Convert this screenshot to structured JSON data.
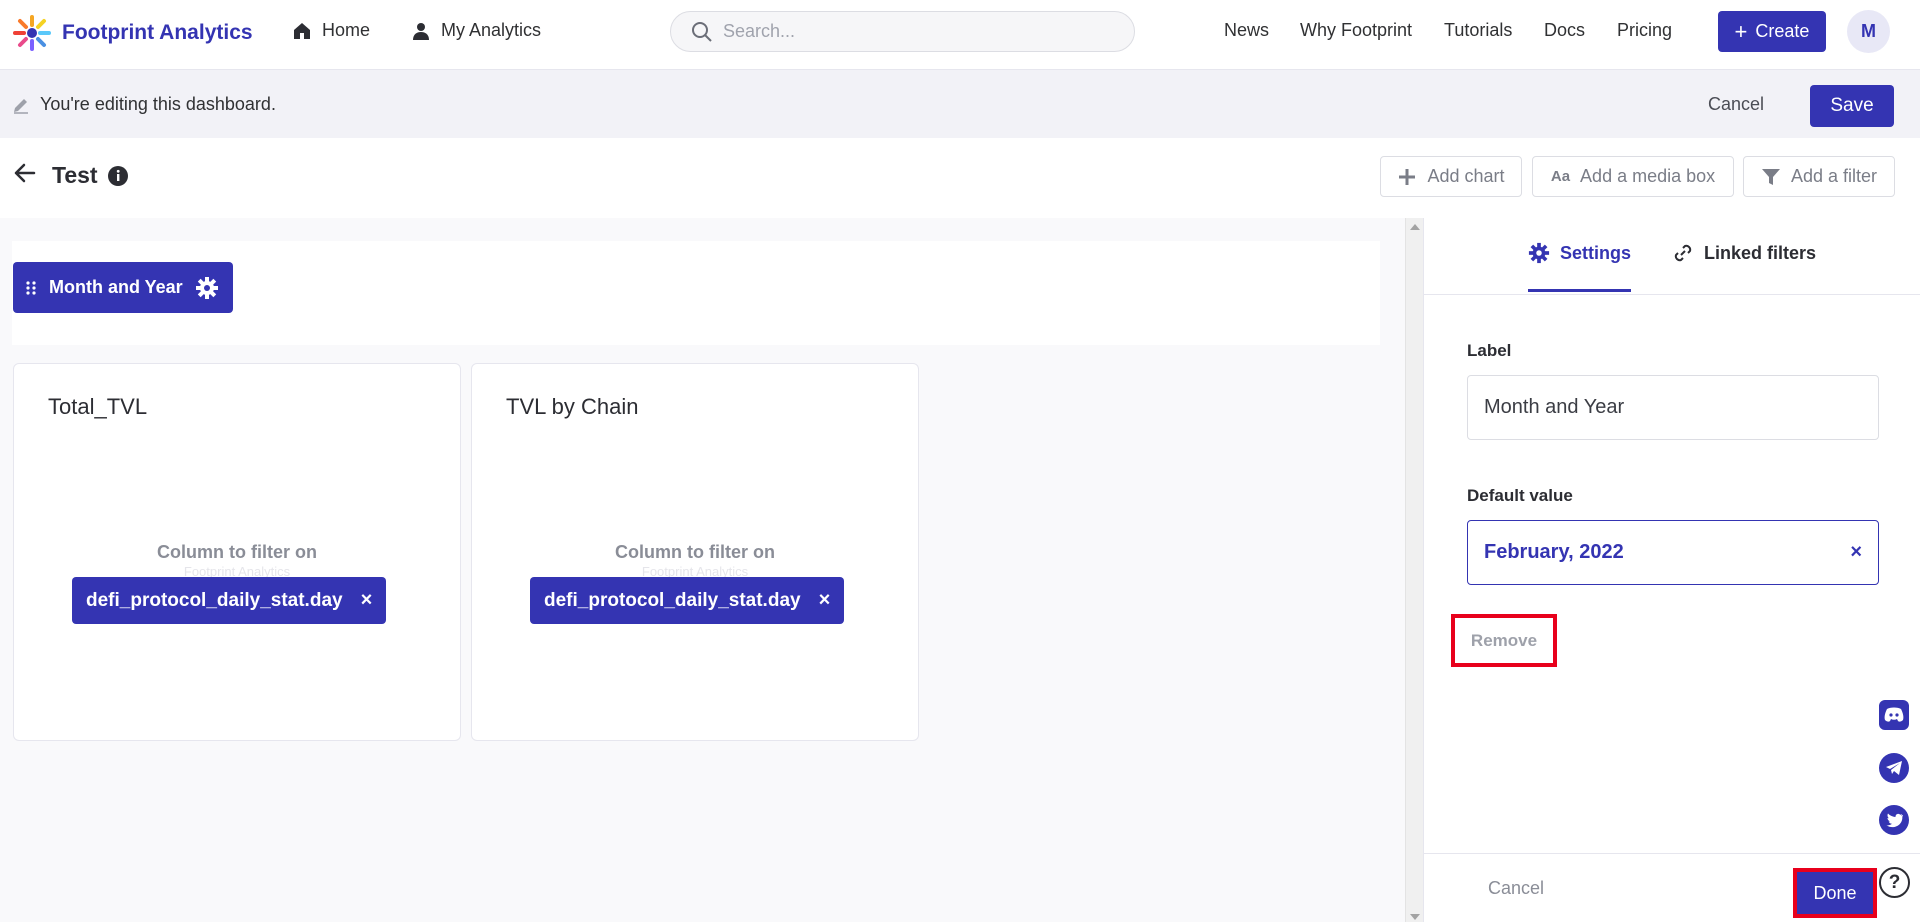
{
  "brand": {
    "name": "Footprint Analytics"
  },
  "topnav": {
    "home": "Home",
    "my_analytics": "My Analytics",
    "search_placeholder": "Search...",
    "links": [
      "News",
      "Why Footprint",
      "Tutorials",
      "Docs",
      "Pricing"
    ],
    "create": "Create",
    "avatar_initial": "M"
  },
  "editbar": {
    "message": "You're editing this dashboard.",
    "cancel": "Cancel",
    "save": "Save"
  },
  "dashboard": {
    "title": "Test",
    "add_chart": "Add chart",
    "add_media": "Add a media box",
    "add_filter": "Add a filter",
    "add_media_icon_text": "Aa"
  },
  "filter_chip": {
    "label": "Month and Year"
  },
  "cards": [
    {
      "title": "Total_TVL",
      "column_label": "Column to filter on",
      "watermark": "Footprint Analytics",
      "column": "defi_protocol_daily_stat.day",
      "close": "×"
    },
    {
      "title": "TVL by Chain",
      "column_label": "Column to filter on",
      "watermark": "Footprint Analytics",
      "column": "defi_protocol_daily_stat.day",
      "close": "×"
    }
  ],
  "panel": {
    "tab_settings": "Settings",
    "tab_linked": "Linked filters",
    "label_heading": "Label",
    "label_value": "Month and Year",
    "default_heading": "Default value",
    "default_value": "February, 2022",
    "default_clear": "×",
    "remove": "Remove",
    "cancel": "Cancel",
    "done": "Done"
  },
  "help": {
    "symbol": "?"
  },
  "colors": {
    "accent": "#3434b2",
    "highlight": "#e8001c"
  }
}
